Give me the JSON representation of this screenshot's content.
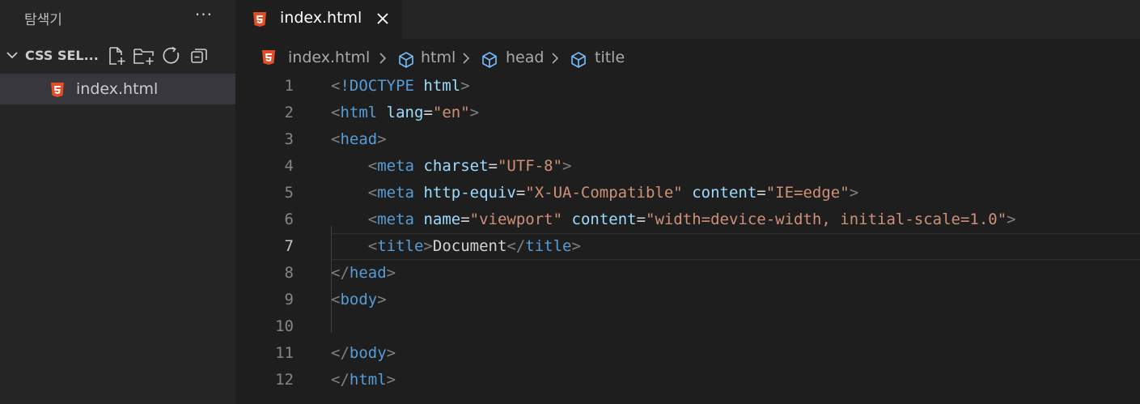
{
  "sidebar": {
    "title": "탐색기",
    "more": "···",
    "section": {
      "title": "CSS SEL..."
    },
    "actions": [
      {
        "icon": "new-file-icon"
      },
      {
        "icon": "new-folder-icon"
      },
      {
        "icon": "refresh-icon"
      },
      {
        "icon": "collapse-all-icon"
      }
    ],
    "files": [
      {
        "name": "index.html",
        "icon": "html5-icon"
      }
    ]
  },
  "tab": {
    "name": "index.html",
    "icon": "html5-icon",
    "close": "close-icon"
  },
  "breadcrumbs": {
    "file": "index.html",
    "items": [
      "html",
      "head",
      "title"
    ]
  },
  "colors": {
    "html5": "#e44d26",
    "tag": "#569cd6",
    "attr": "#9cdcfe",
    "string": "#ce9178",
    "punctuation": "#808080",
    "cube": "#75beff"
  },
  "code": {
    "active_line": 7,
    "lines": [
      {
        "n": "1",
        "tokens": [
          [
            "punc",
            "<"
          ],
          [
            "tag",
            "!DOCTYPE"
          ],
          [
            "text",
            " "
          ],
          [
            "attr",
            "html"
          ],
          [
            "punc",
            ">"
          ]
        ]
      },
      {
        "n": "2",
        "tokens": [
          [
            "punc",
            "<"
          ],
          [
            "tag",
            "html"
          ],
          [
            "text",
            " "
          ],
          [
            "attr",
            "lang"
          ],
          [
            "eq",
            "="
          ],
          [
            "str",
            "\"en\""
          ],
          [
            "punc",
            ">"
          ]
        ]
      },
      {
        "n": "3",
        "tokens": [
          [
            "punc",
            "<"
          ],
          [
            "tag",
            "head"
          ],
          [
            "punc",
            ">"
          ]
        ]
      },
      {
        "n": "4",
        "tokens": [
          [
            "text",
            "    "
          ],
          [
            "punc",
            "<"
          ],
          [
            "tag",
            "meta"
          ],
          [
            "text",
            " "
          ],
          [
            "attr",
            "charset"
          ],
          [
            "eq",
            "="
          ],
          [
            "str",
            "\"UTF-8\""
          ],
          [
            "punc",
            ">"
          ]
        ]
      },
      {
        "n": "5",
        "tokens": [
          [
            "text",
            "    "
          ],
          [
            "punc",
            "<"
          ],
          [
            "tag",
            "meta"
          ],
          [
            "text",
            " "
          ],
          [
            "attr",
            "http-equiv"
          ],
          [
            "eq",
            "="
          ],
          [
            "str",
            "\"X-UA-Compatible\""
          ],
          [
            "text",
            " "
          ],
          [
            "attr",
            "content"
          ],
          [
            "eq",
            "="
          ],
          [
            "str",
            "\"IE=edge\""
          ],
          [
            "punc",
            ">"
          ]
        ]
      },
      {
        "n": "6",
        "tokens": [
          [
            "text",
            "    "
          ],
          [
            "punc",
            "<"
          ],
          [
            "tag",
            "meta"
          ],
          [
            "text",
            " "
          ],
          [
            "attr",
            "name"
          ],
          [
            "eq",
            "="
          ],
          [
            "str",
            "\"viewport\""
          ],
          [
            "text",
            " "
          ],
          [
            "attr",
            "content"
          ],
          [
            "eq",
            "="
          ],
          [
            "str",
            "\"width=device-width, initial-scale=1.0\""
          ],
          [
            "punc",
            ">"
          ]
        ]
      },
      {
        "n": "7",
        "tokens": [
          [
            "text",
            "    "
          ],
          [
            "punc",
            "<"
          ],
          [
            "tag",
            "title"
          ],
          [
            "punc",
            ">"
          ],
          [
            "text",
            "Document"
          ],
          [
            "punc",
            "</"
          ],
          [
            "tag",
            "title"
          ],
          [
            "punc",
            ">"
          ]
        ]
      },
      {
        "n": "8",
        "tokens": [
          [
            "punc",
            "</"
          ],
          [
            "tag",
            "head"
          ],
          [
            "punc",
            ">"
          ]
        ]
      },
      {
        "n": "9",
        "tokens": [
          [
            "punc",
            "<"
          ],
          [
            "tag",
            "body"
          ],
          [
            "punc",
            ">"
          ]
        ]
      },
      {
        "n": "10",
        "tokens": []
      },
      {
        "n": "11",
        "tokens": [
          [
            "punc",
            "</"
          ],
          [
            "tag",
            "body"
          ],
          [
            "punc",
            ">"
          ]
        ]
      },
      {
        "n": "12",
        "tokens": [
          [
            "punc",
            "</"
          ],
          [
            "tag",
            "html"
          ],
          [
            "punc",
            ">"
          ]
        ]
      }
    ]
  }
}
